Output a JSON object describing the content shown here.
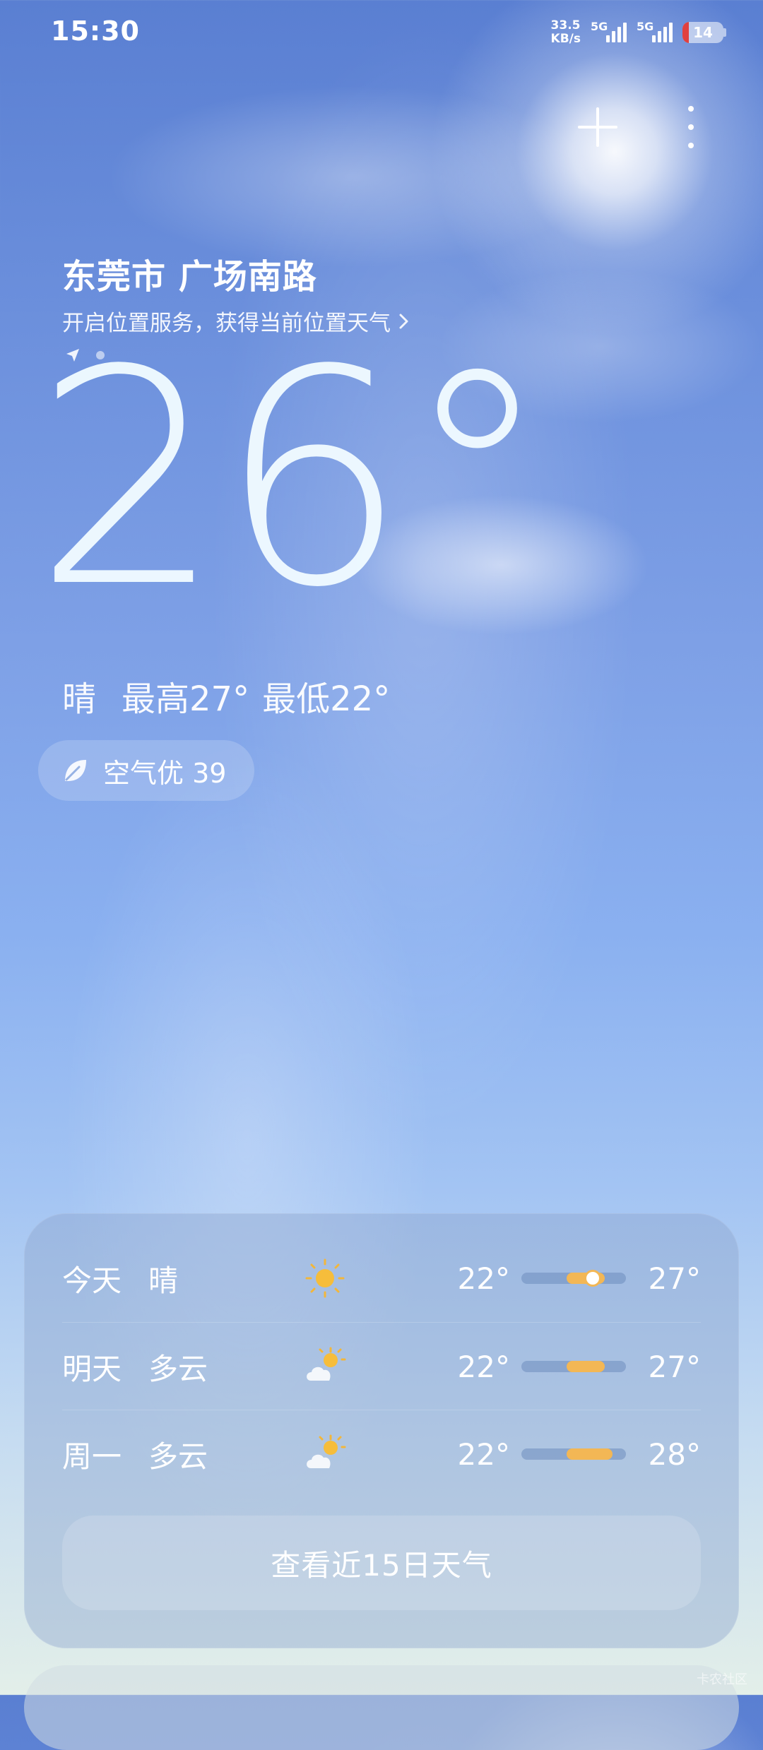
{
  "status_bar": {
    "time": "15:30",
    "net_speed_value": "33.5",
    "net_speed_unit": "KB/s",
    "signal_1_label": "5G",
    "signal_2_label": "5G",
    "battery_level": "14",
    "battery_color": "#e0403f"
  },
  "toolbar": {
    "add_icon": "plus-icon",
    "more_icon": "more-vertical-icon"
  },
  "location": {
    "name": "东莞市 广场南路",
    "hint": "开启位置服务，获得当前位置天气",
    "hint_icon": "chevron-right-icon"
  },
  "current": {
    "temperature": "26°",
    "condition": "晴",
    "high": "最高27°",
    "low": "最低22°",
    "aqi_label": "空气优 39",
    "aqi_icon": "leaf-icon"
  },
  "forecast": {
    "days": [
      {
        "day": "今天",
        "condition": "晴",
        "icon": "sun-icon",
        "low": "22°",
        "high": "27°",
        "range_start": 0.43,
        "range_end": 0.8,
        "current_marker": 0.68
      },
      {
        "day": "明天",
        "condition": "多云",
        "icon": "partly-cloudy-icon",
        "low": "22°",
        "high": "27°",
        "range_start": 0.43,
        "range_end": 0.8
      },
      {
        "day": "周一",
        "condition": "多云",
        "icon": "partly-cloudy-icon",
        "low": "22°",
        "high": "28°",
        "range_start": 0.43,
        "range_end": 0.87
      }
    ],
    "more_button": "查看近15日天气",
    "bar_color": "#f3b755"
  },
  "watermark": "卡农社区"
}
